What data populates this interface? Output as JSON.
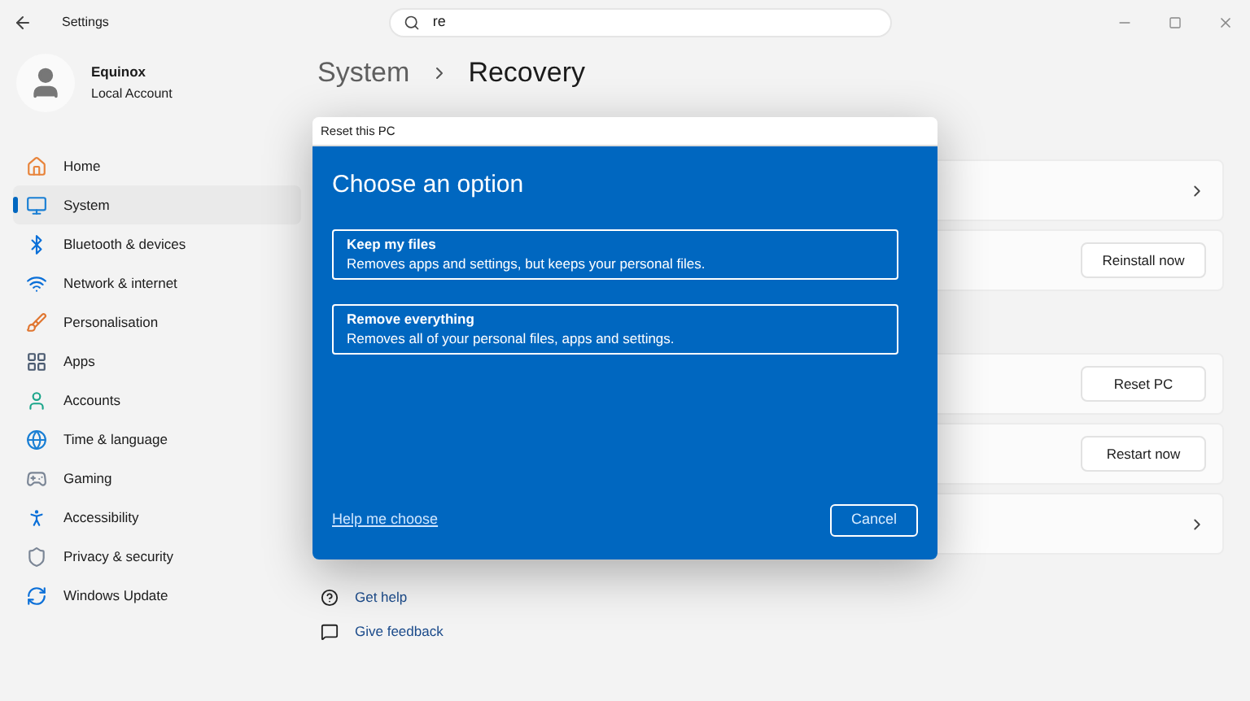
{
  "window": {
    "title": "Settings"
  },
  "search": {
    "value": "re"
  },
  "account": {
    "name": "Equinox",
    "type": "Local Account"
  },
  "sidebar": {
    "items": [
      {
        "label": "Home",
        "selected": false
      },
      {
        "label": "System",
        "selected": true
      },
      {
        "label": "Bluetooth & devices",
        "selected": false
      },
      {
        "label": "Network & internet",
        "selected": false
      },
      {
        "label": "Personalisation",
        "selected": false
      },
      {
        "label": "Apps",
        "selected": false
      },
      {
        "label": "Accounts",
        "selected": false
      },
      {
        "label": "Time & language",
        "selected": false
      },
      {
        "label": "Gaming",
        "selected": false
      },
      {
        "label": "Accessibility",
        "selected": false
      },
      {
        "label": "Privacy & security",
        "selected": false
      },
      {
        "label": "Windows Update",
        "selected": false
      }
    ]
  },
  "breadcrumb": [
    "System",
    "Recovery"
  ],
  "sections": [
    {
      "cards": [
        {
          "kind": "chevron"
        },
        {
          "kind": "button",
          "button": "Reinstall now"
        }
      ]
    },
    {
      "cards": [
        {
          "kind": "button",
          "button": "Reset PC"
        },
        {
          "kind": "button",
          "button": "Restart now"
        },
        {
          "kind": "chevron"
        }
      ]
    }
  ],
  "links": [
    {
      "label": "Get help"
    },
    {
      "label": "Give feedback"
    }
  ],
  "dialog": {
    "title": "Reset this PC",
    "heading": "Choose an option",
    "options": [
      {
        "title": "Keep my files",
        "description": "Removes apps and settings, but keeps your personal files."
      },
      {
        "title": "Remove everything",
        "description": "Removes all of your personal files, apps and settings."
      }
    ],
    "help_link": "Help me choose",
    "cancel": "Cancel"
  }
}
